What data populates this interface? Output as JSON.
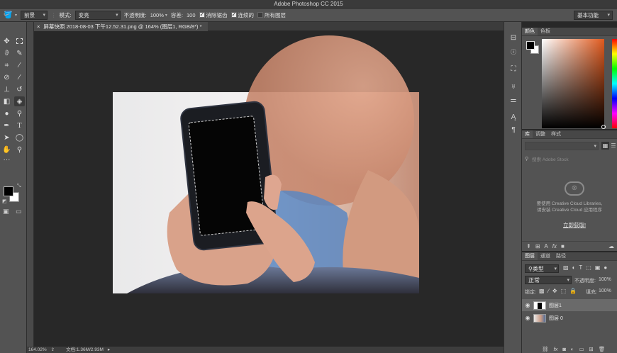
{
  "title_bar": {
    "app_title": "Adobe Photoshop CC 2015"
  },
  "options_bar": {
    "preset_label": "前景",
    "mode_label": "模式:",
    "mode_value": "变亮",
    "opacity_label": "不透明度:",
    "opacity_value": "100%",
    "tolerance_label": "容差:",
    "tolerance_value": "100",
    "antialias_label": "消除锯齿",
    "antialias_checked": true,
    "contiguous_label": "连续的",
    "contiguous_checked": true,
    "all_layers_label": "所有图层",
    "all_layers_checked": false,
    "workspace_label": "基本功能"
  },
  "document": {
    "tab_title": "屏幕快照 2018-08-03 下午12.52.31.png @ 164% (图层1, RGB/8*) *",
    "close_glyph": "×"
  },
  "status_bar": {
    "zoom": "164.02%",
    "doc_info": "文档:1.36M/2.93M",
    "arrow": "▸"
  },
  "color_panel": {
    "tabs": [
      "颜色",
      "色板"
    ],
    "foreground": "#000000",
    "background": "#ffffff",
    "hue_color": "#e05a1e"
  },
  "library_panel": {
    "tabs": [
      "库",
      "调整",
      "样式"
    ],
    "search_placeholder": "搜索 Adobe Stock",
    "message_line1": "要使用 Creative Cloud Libraries,",
    "message_line2": "请安装 Creative Cloud 应用程序",
    "link": "立即获取!"
  },
  "layers_panel": {
    "tabs": [
      "图层",
      "通道",
      "路径"
    ],
    "kind_filter": "类型",
    "blend_mode": "正常",
    "opacity_label": "不透明度:",
    "opacity_value": "100%",
    "lock_label": "锁定:",
    "fill_label": "填充:",
    "fill_value": "100%",
    "layers": [
      {
        "name": "图层1",
        "selected": true
      },
      {
        "name": "图层 0",
        "selected": false
      }
    ]
  },
  "toolbar": {
    "fg_color": "#000000",
    "bg_color": "#ffffff"
  }
}
